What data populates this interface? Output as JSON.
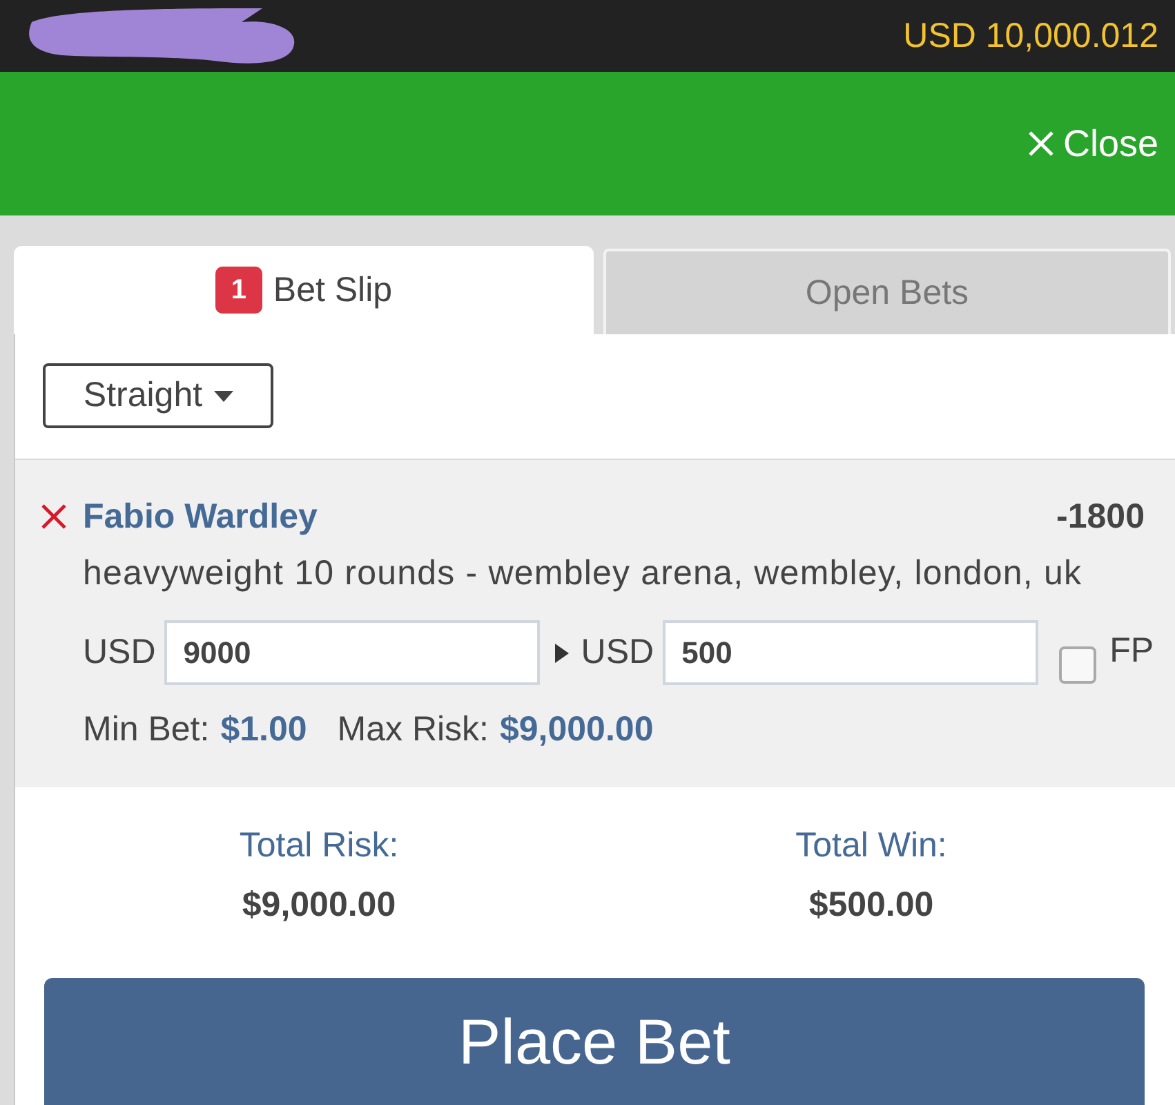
{
  "header": {
    "balance": "USD 10,000.012"
  },
  "toolbar": {
    "close_label": "Close"
  },
  "tabs": [
    {
      "label": "Bet Slip",
      "badge": "1",
      "selected": true
    },
    {
      "label": "Open Bets",
      "selected": false
    }
  ],
  "bet_type": {
    "value": "Straight"
  },
  "selections": [
    {
      "name": "Fabio Wardley",
      "odds": "-1800",
      "description": "heavyweight 10 rounds - wembley arena, wembley, london, uk",
      "risk_currency": "USD",
      "risk": "9000",
      "win_currency": "USD",
      "win": "500",
      "free_play": {
        "label": "FP",
        "checked": false
      },
      "min_bet_label": "Min Bet:",
      "min_bet": "$1.00",
      "max_risk_label": "Max Risk:",
      "max_risk": "$9,000.00"
    }
  ],
  "totals": [
    {
      "label": "Total Risk:",
      "value": "$9,000.00"
    },
    {
      "label": "Total Win:",
      "value": "$500.00"
    }
  ],
  "place_bet_label": "Place Bet"
}
